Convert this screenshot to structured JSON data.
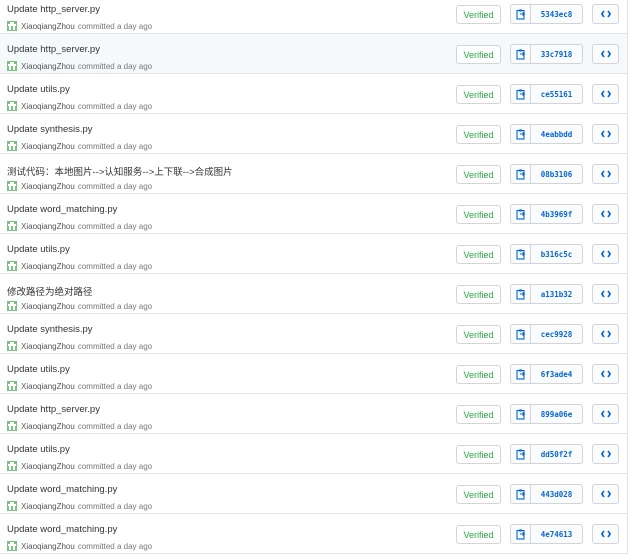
{
  "colors": {
    "accent": "#0366d6",
    "verified": "#28a745",
    "avatar": "#5cb85c"
  },
  "icons": {
    "copy": "clipboard-icon",
    "browse": "code-icon"
  },
  "commits": [
    {
      "title": "Update http_server.py",
      "author": "XiaoqiangZhou",
      "time": "committed a day ago",
      "verified": "Verified",
      "sha": "5343ec8"
    },
    {
      "title": "Update http_server.py",
      "author": "XiaoqiangZhou",
      "time": "committed a day ago",
      "verified": "Verified",
      "sha": "33c7918"
    },
    {
      "title": "Update utils.py",
      "author": "XiaoqiangZhou",
      "time": "committed a day ago",
      "verified": "Verified",
      "sha": "ce55161"
    },
    {
      "title": "Update synthesis.py",
      "author": "XiaoqiangZhou",
      "time": "committed a day ago",
      "verified": "Verified",
      "sha": "4eabbdd"
    },
    {
      "title": "测试代码：本地图片-->认知服务-->上下联-->合成图片",
      "author": "XiaoqiangZhou",
      "time": "committed a day ago",
      "verified": "Verified",
      "sha": "08b3106"
    },
    {
      "title": "Update word_matching.py",
      "author": "XiaoqiangZhou",
      "time": "committed a day ago",
      "verified": "Verified",
      "sha": "4b3969f"
    },
    {
      "title": "Update utils.py",
      "author": "XiaoqiangZhou",
      "time": "committed a day ago",
      "verified": "Verified",
      "sha": "b316c5c"
    },
    {
      "title": "修改路径为绝对路径",
      "author": "XiaoqiangZhou",
      "time": "committed a day ago",
      "verified": "Verified",
      "sha": "a131b32"
    },
    {
      "title": "Update synthesis.py",
      "author": "XiaoqiangZhou",
      "time": "committed a day ago",
      "verified": "Verified",
      "sha": "cec9928"
    },
    {
      "title": "Update utils.py",
      "author": "XiaoqiangZhou",
      "time": "committed a day ago",
      "verified": "Verified",
      "sha": "6f3ade4"
    },
    {
      "title": "Update http_server.py",
      "author": "XiaoqiangZhou",
      "time": "committed a day ago",
      "verified": "Verified",
      "sha": "899a06e"
    },
    {
      "title": "Update utils.py",
      "author": "XiaoqiangZhou",
      "time": "committed a day ago",
      "verified": "Verified",
      "sha": "dd50f2f"
    },
    {
      "title": "Update word_matching.py",
      "author": "XiaoqiangZhou",
      "time": "committed a day ago",
      "verified": "Verified",
      "sha": "443d028"
    },
    {
      "title": "Update word_matching.py",
      "author": "XiaoqiangZhou",
      "time": "committed a day ago",
      "verified": "Verified",
      "sha": "4e74613"
    }
  ]
}
